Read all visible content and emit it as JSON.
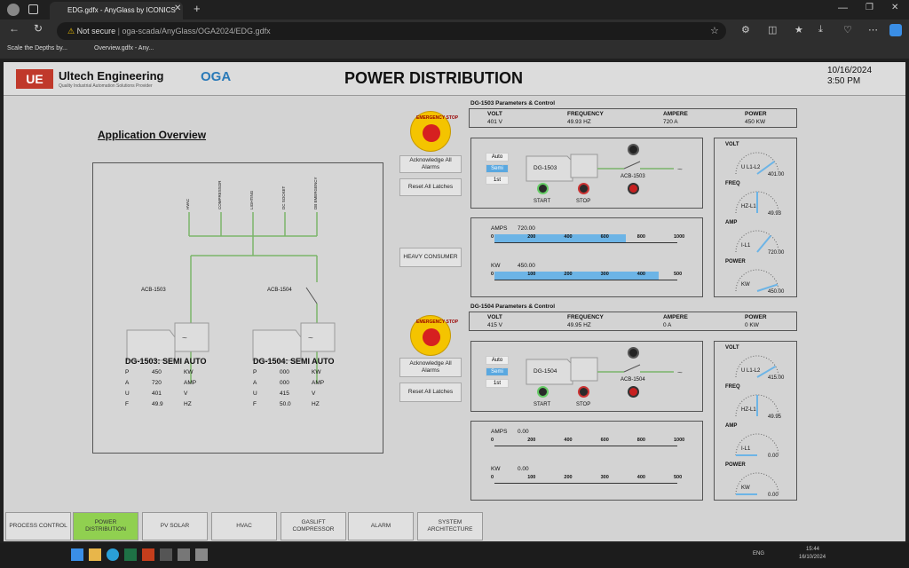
{
  "browser": {
    "tab_title": "EDG.gdfx - AnyGlass by ICONICS",
    "url_secure": "Not secure",
    "url": "oga-scada/AnyGlass/OGA2024/EDG.gdfx",
    "bookmarks": [
      "Scale the Depths by...",
      "Overview.gdfx - Any..."
    ]
  },
  "header": {
    "logo_text": "Ultech Engineering",
    "tagline": "Quality Industrial Automation Solutions Provider",
    "oga_logo": "OGA",
    "title": "POWER DISTRIBUTION",
    "date": "10/16/2024",
    "time": "3:50 PM"
  },
  "overview": {
    "title": "Application Overview",
    "feeders": [
      "HVAC",
      "COMPRESSOR",
      "LIGHTING",
      "DC SOCKET",
      "DB EMERGENCY"
    ],
    "acb1": "ACB-1503",
    "acb2": "ACB-1504",
    "gen1": {
      "title": "DG-1503: SEMI AUTO",
      "rows": [
        [
          "P",
          "450",
          "KW"
        ],
        [
          "A",
          "720",
          "AMP"
        ],
        [
          "U",
          "401",
          "V"
        ],
        [
          "F",
          "49.9",
          "HZ"
        ]
      ]
    },
    "gen2": {
      "title": "DG-1504: SEMI AUTO",
      "rows": [
        [
          "P",
          "000",
          "KW"
        ],
        [
          "A",
          "000",
          "AMP"
        ],
        [
          "U",
          "415",
          "V"
        ],
        [
          "F",
          "50.0",
          "HZ"
        ]
      ]
    }
  },
  "controls": {
    "emergency": "EMERGENCY STOP",
    "ack": "Acknowledge All Alarms",
    "reset": "Reset All Latches",
    "heavy": "HEAVY CONSUMER"
  },
  "dg1": {
    "title": "DG-1503 Parameters & Control",
    "labels": [
      "VOLT",
      "FREQUENCY",
      "AMPERE",
      "POWER"
    ],
    "values": [
      "401 V",
      "49.93 HZ",
      "720 A",
      "450 KW"
    ],
    "modes": [
      "Auto",
      "Semi",
      "1st"
    ],
    "selected_mode": "Semi",
    "gen": "DG-1503",
    "acb": "ACB-1503",
    "start": "START",
    "stop": "STOP",
    "amps_label": "AMPS",
    "amps_value": "720.00",
    "amps_ticks": [
      "0",
      "200",
      "400",
      "600",
      "800",
      "1000"
    ],
    "amps_fill": 0.72,
    "kw_label": "KW",
    "kw_value": "450.00",
    "kw_ticks": [
      "0",
      "100",
      "200",
      "300",
      "400",
      "500"
    ],
    "kw_fill": 0.9,
    "gauges": [
      {
        "title": "VOLT",
        "label": "U L1-L2",
        "value": "401.00",
        "level": 0.8
      },
      {
        "title": "FREQ",
        "label": "HZ-L1",
        "value": "49.93",
        "level": 0.5
      },
      {
        "title": "AMP",
        "label": "I-L1",
        "value": "720.00",
        "level": 0.72
      },
      {
        "title": "POWER",
        "label": "KW",
        "value": "450.00",
        "level": 0.9
      }
    ]
  },
  "dg2": {
    "title": "DG-1504 Parameters & Control",
    "labels": [
      "VOLT",
      "FREQUENCY",
      "AMPERE",
      "POWER"
    ],
    "values": [
      "415 V",
      "49.95 HZ",
      "0 A",
      "0 KW"
    ],
    "modes": [
      "Auto",
      "Semi",
      "1st"
    ],
    "selected_mode": "Semi",
    "gen": "DG-1504",
    "acb": "ACB-1504",
    "start": "START",
    "stop": "STOP",
    "amps_label": "AMPS",
    "amps_value": "0.00",
    "amps_ticks": [
      "0",
      "200",
      "400",
      "600",
      "800",
      "1000"
    ],
    "amps_fill": 0,
    "kw_label": "KW",
    "kw_value": "0.00",
    "kw_ticks": [
      "0",
      "100",
      "200",
      "300",
      "400",
      "500"
    ],
    "kw_fill": 0,
    "gauges": [
      {
        "title": "VOLT",
        "label": "U L1-L2",
        "value": "415.00",
        "level": 0.83
      },
      {
        "title": "FREQ",
        "label": "HZ-L1",
        "value": "49.95",
        "level": 0.5
      },
      {
        "title": "AMP",
        "label": "I-L1",
        "value": "0.00",
        "level": 0
      },
      {
        "title": "POWER",
        "label": "KW",
        "value": "0.00",
        "level": 0
      }
    ]
  },
  "nav": [
    "PROCESS CONTROL",
    "POWER DISTRIBUTION",
    "PV SOLAR",
    "HVAC",
    "GASLIFT COMPRESSOR",
    "ALARM",
    "SYSTEM ARCHITECTURE"
  ],
  "nav_active": "POWER DISTRIBUTION",
  "taskbar": {
    "lang": "ENG",
    "time": "15:44",
    "date": "16/10/2024"
  },
  "colors": {
    "accent": "#5aa8e0",
    "active_nav": "#90d050",
    "estop": "#d62020"
  }
}
